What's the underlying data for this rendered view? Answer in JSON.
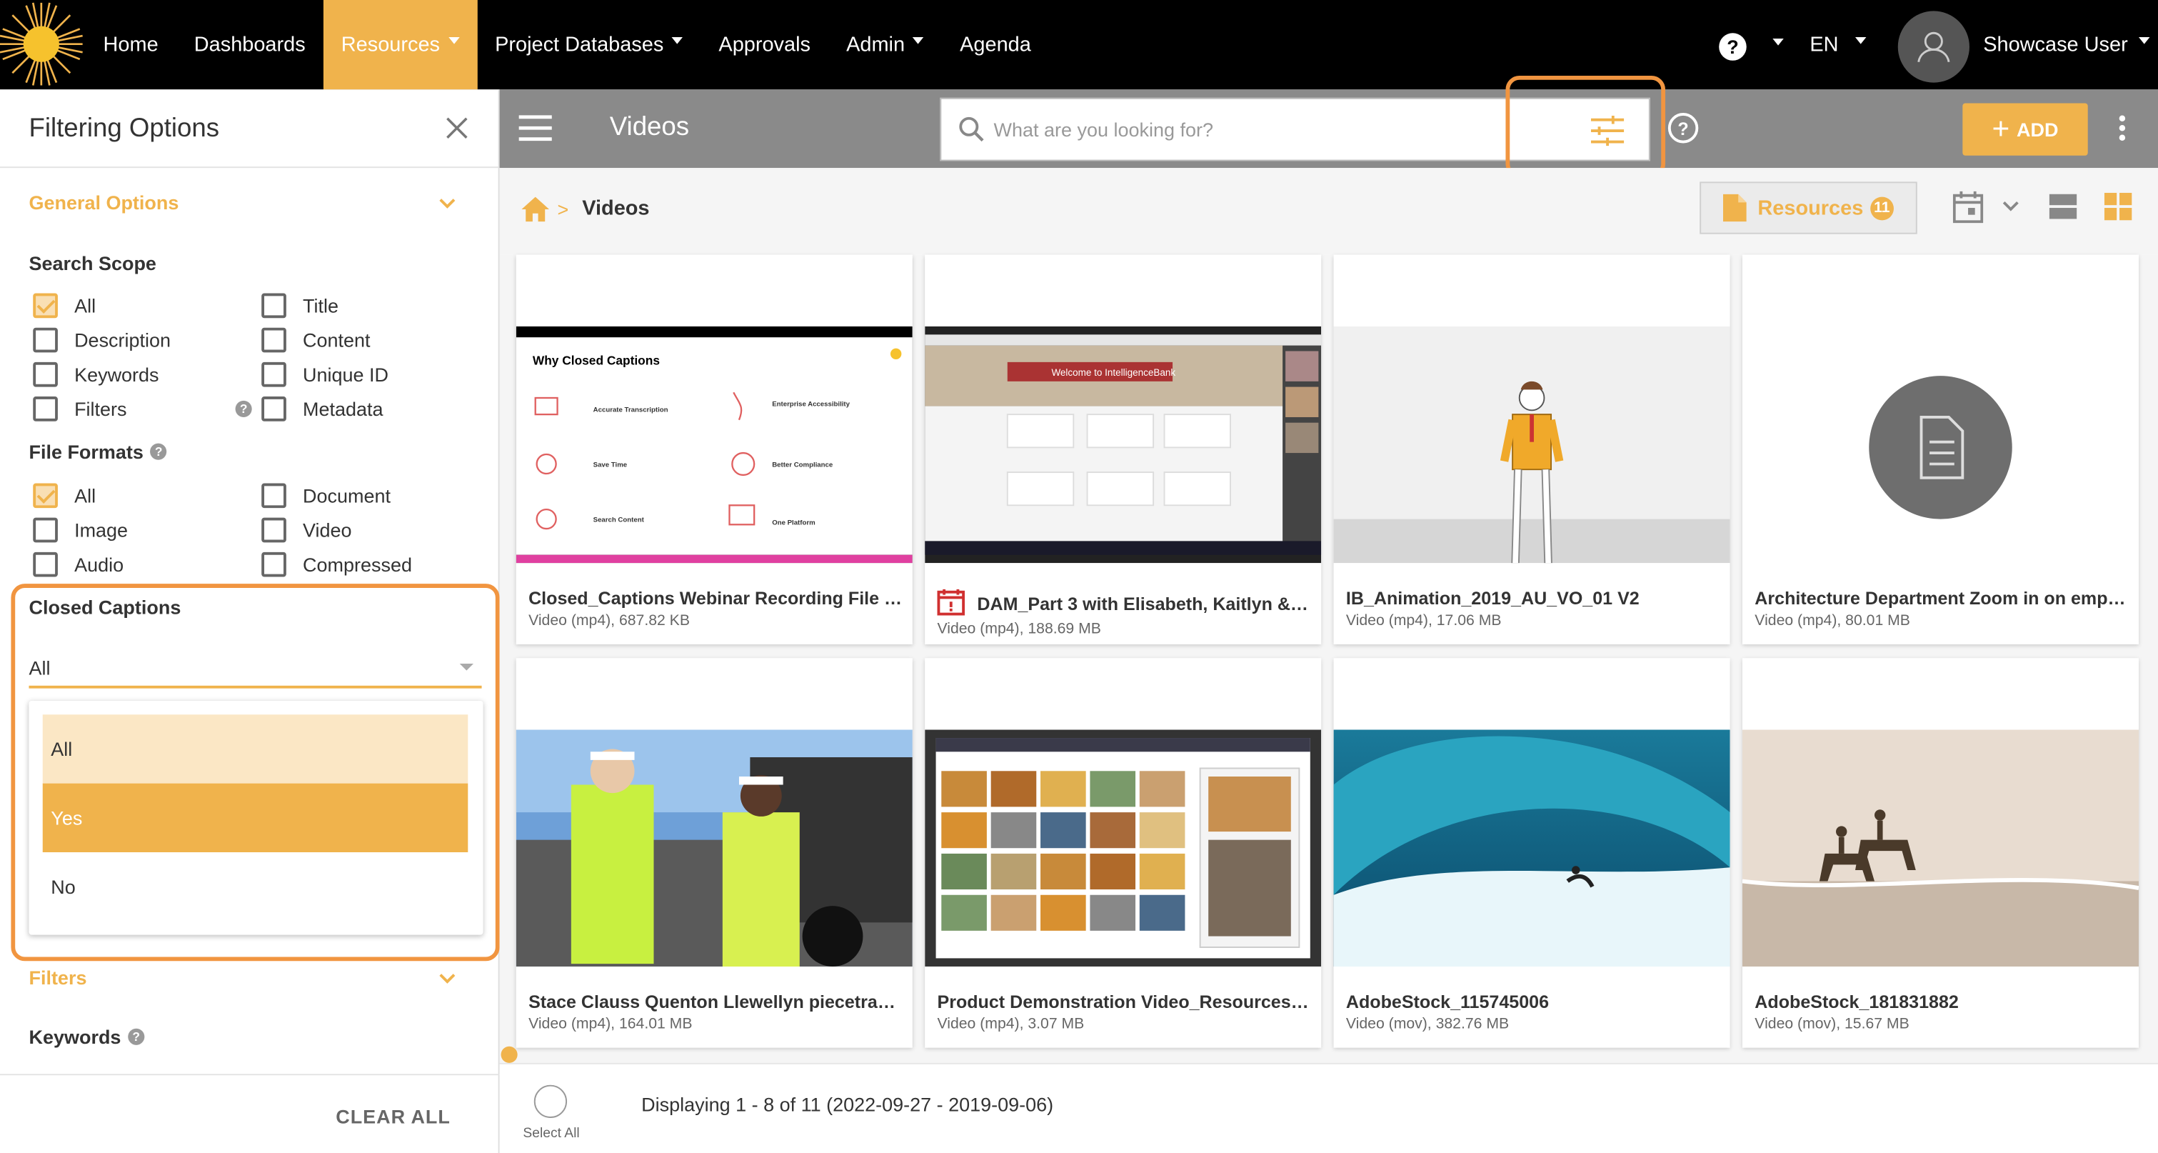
{
  "nav": {
    "items": [
      {
        "label": "Home",
        "dropdown": false,
        "active": false
      },
      {
        "label": "Dashboards",
        "dropdown": false,
        "active": false
      },
      {
        "label": "Resources",
        "dropdown": true,
        "active": true
      },
      {
        "label": "Project Databases",
        "dropdown": true,
        "active": false
      },
      {
        "label": "Approvals",
        "dropdown": false,
        "active": false
      },
      {
        "label": "Admin",
        "dropdown": true,
        "active": false
      },
      {
        "label": "Agenda",
        "dropdown": false,
        "active": false
      }
    ],
    "help_glyph": "?",
    "language": "EN",
    "user_name": "Showcase User"
  },
  "sidebar": {
    "title": "Filtering Options",
    "general_options": "General Options",
    "search_scope": {
      "label": "Search Scope",
      "options": [
        {
          "label": "All",
          "checked": true
        },
        {
          "label": "Title",
          "checked": false
        },
        {
          "label": "Description",
          "checked": false
        },
        {
          "label": "Content",
          "checked": false
        },
        {
          "label": "Keywords",
          "checked": false
        },
        {
          "label": "Unique ID",
          "checked": false
        },
        {
          "label": "Filters",
          "checked": false
        },
        {
          "label": "Metadata",
          "checked": false
        }
      ]
    },
    "file_formats": {
      "label": "File Formats",
      "options": [
        {
          "label": "All",
          "checked": true
        },
        {
          "label": "Document",
          "checked": false
        },
        {
          "label": "Image",
          "checked": false
        },
        {
          "label": "Video",
          "checked": false
        },
        {
          "label": "Audio",
          "checked": false
        },
        {
          "label": "Compressed",
          "checked": false
        }
      ]
    },
    "closed_captions": {
      "label": "Closed Captions",
      "selected": "All",
      "options": [
        "All",
        "Yes",
        "No"
      ]
    },
    "filters": "Filters",
    "keywords": "Keywords",
    "clear_all": "CLEAR ALL"
  },
  "toolbar": {
    "title": "Videos",
    "search_placeholder": "What are you looking for?",
    "help_glyph": "?",
    "add_label": "ADD"
  },
  "breadcrumb": {
    "current": "Videos",
    "separator": ">"
  },
  "resources_button": {
    "label": "Resources",
    "count": "11"
  },
  "videos": [
    {
      "title": "Closed_Captions Webinar Recording File E…",
      "meta": "Video (mp4), 687.82 KB",
      "thumb": "slide",
      "slide_title": "Why Closed Captions",
      "slide_items": [
        "Accurate Transcription",
        "Enterprise Accessibility",
        "Save Time",
        "Better Compliance",
        "Search Content",
        "One Platform"
      ]
    },
    {
      "title": "DAM_Part 3 with Elisabeth, Kaitlyn & T…",
      "meta": "Video (mp4), 188.69 MB",
      "thumb": "screen",
      "banner": "Welcome to IntelligenceBank"
    },
    {
      "title": "IB_Animation_2019_AU_VO_01 V2",
      "meta": "Video (mp4), 17.06 MB",
      "thumb": "figure"
    },
    {
      "title": "Architecture Department Zoom in on empl…",
      "meta": "Video (mp4), 80.01 MB",
      "thumb": "doc-placeholder"
    },
    {
      "title": "Stace Clauss Quenton Llewellyn piecetrac…",
      "meta": "Video (mp4), 164.01 MB",
      "thumb": "workers"
    },
    {
      "title": "Product Demonstration Video_Resources(…",
      "meta": "Video (mp4), 3.07 MB",
      "thumb": "gallery"
    },
    {
      "title": "AdobeStock_115745006",
      "meta": "Video (mov), 382.76 MB",
      "thumb": "wave"
    },
    {
      "title": "AdobeStock_181831882",
      "meta": "Video (mov), 15.67 MB",
      "thumb": "beach"
    }
  ],
  "footer": {
    "select_all": "Select All",
    "display_text": "Displaying 1 - 8 of 11 (2022-09-27 - 2019-09-06)"
  },
  "colors": {
    "accent": "#f0b34c",
    "highlight": "#f19540",
    "toolbar": "#8a8a8a",
    "topbar": "#000000"
  }
}
